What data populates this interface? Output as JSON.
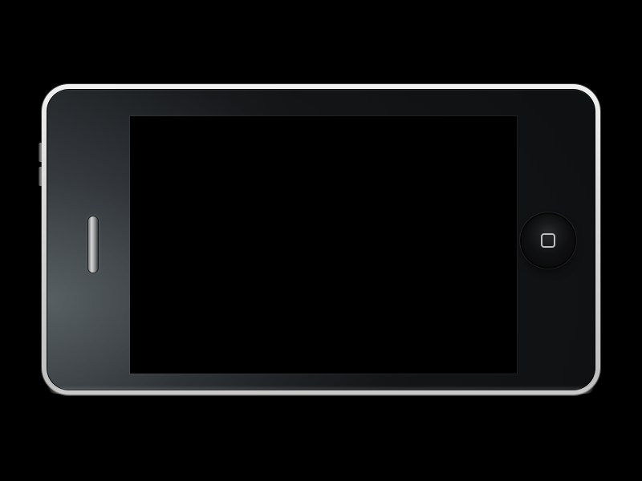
{
  "scene": {
    "background_color": "#000000",
    "device": {
      "type": "smartphone",
      "orientation": "landscape",
      "frame_color": "#e0e0e0",
      "bezel_color": "#0f1011",
      "screen_color": "#000000",
      "elements": {
        "speaker": "speaker-slit",
        "home_button": "home-button",
        "home_icon": "rounded-square-icon"
      }
    }
  }
}
